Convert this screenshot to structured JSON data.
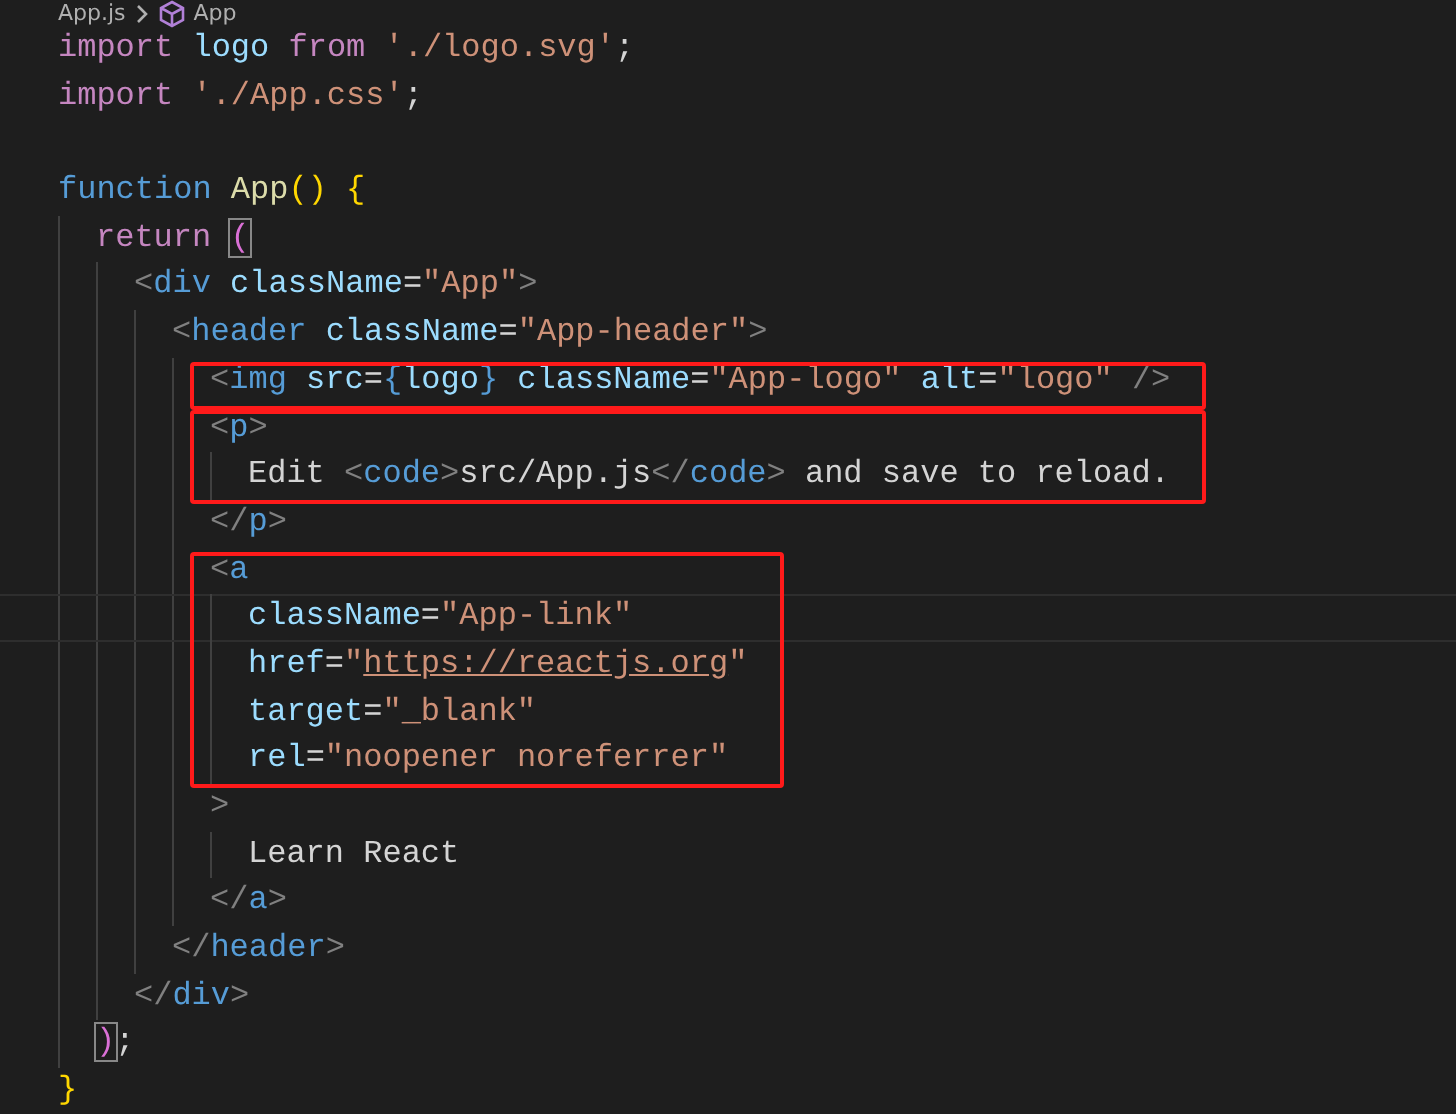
{
  "breadcrumb": {
    "file": "App.js",
    "symbol": "App"
  },
  "lines": [
    {
      "tokens": [
        {
          "kind": "keyword",
          "text": "import "
        },
        {
          "kind": "variable",
          "text": "logo "
        },
        {
          "kind": "keyword",
          "text": "from "
        },
        {
          "kind": "string",
          "text": "'./logo.svg'"
        },
        {
          "kind": "plain",
          "text": ";"
        }
      ],
      "highlighted": false,
      "current": false
    },
    {
      "tokens": [
        {
          "kind": "keyword",
          "text": "import "
        },
        {
          "kind": "string",
          "text": "'./App.css'"
        },
        {
          "kind": "plain",
          "text": ";"
        }
      ],
      "highlighted": false,
      "current": false
    },
    {
      "highlighted": false,
      "current": false
    },
    {
      "tokens": [
        {
          "kind": "storage",
          "text": "function "
        },
        {
          "kind": "function",
          "text": "App"
        },
        {
          "kind": "brace",
          "text": "() {"
        }
      ],
      "highlighted": false,
      "current": false,
      "children": [
        {
          "tokens": [
            {
              "kind": "keyword",
              "text": "return "
            },
            {
              "kind": "matched",
              "text": "("
            }
          ],
          "highlighted": false,
          "current": false,
          "children": [
            {
              "tokens": [
                {
                  "kind": "bracket",
                  "text": "<"
                },
                {
                  "kind": "storage",
                  "text": "div "
                },
                {
                  "kind": "variable",
                  "text": "className"
                },
                {
                  "kind": "plain",
                  "text": "="
                },
                {
                  "kind": "string",
                  "text": "\"App\""
                },
                {
                  "kind": "bracket",
                  "text": ">"
                }
              ],
              "highlighted": false,
              "current": false,
              "children": [
                {
                  "tokens": [
                    {
                      "kind": "bracket",
                      "text": "<"
                    },
                    {
                      "kind": "storage",
                      "text": "header "
                    },
                    {
                      "kind": "variable",
                      "text": "className"
                    },
                    {
                      "kind": "plain",
                      "text": "="
                    },
                    {
                      "kind": "string",
                      "text": "\"App-header\""
                    },
                    {
                      "kind": "bracket",
                      "text": ">"
                    }
                  ],
                  "highlighted": false,
                  "current": false,
                  "children": [
                    {
                      "tokens": [
                        {
                          "kind": "bracket",
                          "text": "<"
                        },
                        {
                          "kind": "storage",
                          "text": "img "
                        },
                        {
                          "kind": "variable",
                          "text": "src"
                        },
                        {
                          "kind": "plain",
                          "text": "="
                        },
                        {
                          "kind": "storage",
                          "text": "{"
                        },
                        {
                          "kind": "variable",
                          "text": "logo"
                        },
                        {
                          "kind": "storage",
                          "text": "} "
                        },
                        {
                          "kind": "variable",
                          "text": "className"
                        },
                        {
                          "kind": "plain",
                          "text": "="
                        },
                        {
                          "kind": "string",
                          "text": "\"App-logo\" "
                        },
                        {
                          "kind": "variable",
                          "text": "alt"
                        },
                        {
                          "kind": "plain",
                          "text": "="
                        },
                        {
                          "kind": "string",
                          "text": "\"logo\" "
                        },
                        {
                          "kind": "bracket",
                          "text": "/>"
                        }
                      ],
                      "highlighted": true,
                      "current": false
                    },
                    {
                      "tokens": [
                        {
                          "kind": "bracket",
                          "text": "<"
                        },
                        {
                          "kind": "storage",
                          "text": "p"
                        },
                        {
                          "kind": "bracket",
                          "text": ">"
                        }
                      ],
                      "highlighted": true,
                      "current": false,
                      "children": [
                        {
                          "tokens": [
                            {
                              "kind": "plain",
                              "text": "Edit "
                            },
                            {
                              "kind": "bracket",
                              "text": "<"
                            },
                            {
                              "kind": "storage",
                              "text": "code"
                            },
                            {
                              "kind": "bracket",
                              "text": ">"
                            },
                            {
                              "kind": "plain",
                              "text": "src/App.js"
                            },
                            {
                              "kind": "bracket",
                              "text": "</"
                            },
                            {
                              "kind": "storage",
                              "text": "code"
                            },
                            {
                              "kind": "bracket",
                              "text": ">"
                            },
                            {
                              "kind": "plain",
                              "text": " and save to reload."
                            }
                          ],
                          "highlighted": false,
                          "current": false
                        }
                      ]
                    },
                    {
                      "tokens": [
                        {
                          "kind": "bracket",
                          "text": "</"
                        },
                        {
                          "kind": "storage",
                          "text": "p"
                        },
                        {
                          "kind": "bracket",
                          "text": ">"
                        }
                      ],
                      "highlighted": false,
                      "current": false
                    },
                    {
                      "tokens": [
                        {
                          "kind": "bracket",
                          "text": "<"
                        },
                        {
                          "kind": "storage",
                          "text": "a"
                        }
                      ],
                      "highlighted": true,
                      "current": false,
                      "children": [
                        {
                          "tokens": [
                            {
                              "kind": "variable",
                              "text": "className"
                            },
                            {
                              "kind": "plain",
                              "text": "="
                            },
                            {
                              "kind": "string",
                              "text": "\"App-link\""
                            }
                          ],
                          "highlighted": false,
                          "current": true
                        },
                        {
                          "tokens": [
                            {
                              "kind": "variable",
                              "text": "href"
                            },
                            {
                              "kind": "plain",
                              "text": "="
                            },
                            {
                              "kind": "string",
                              "text": "\""
                            },
                            {
                              "kind": "link",
                              "text": "https://reactjs.org"
                            },
                            {
                              "kind": "string",
                              "text": "\""
                            }
                          ],
                          "highlighted": false,
                          "current": false
                        },
                        {
                          "tokens": [
                            {
                              "kind": "variable",
                              "text": "target"
                            },
                            {
                              "kind": "plain",
                              "text": "="
                            },
                            {
                              "kind": "string",
                              "text": "\"_blank\""
                            }
                          ],
                          "highlighted": false,
                          "current": false
                        },
                        {
                          "tokens": [
                            {
                              "kind": "variable",
                              "text": "rel"
                            },
                            {
                              "kind": "plain",
                              "text": "="
                            },
                            {
                              "kind": "string",
                              "text": "\"noopener noreferrer\""
                            }
                          ],
                          "highlighted": false,
                          "current": false
                        }
                      ]
                    },
                    {
                      "tokens": [
                        {
                          "kind": "bracket",
                          "text": ">"
                        }
                      ],
                      "highlighted": false,
                      "current": false,
                      "children": [
                        {
                          "tokens": [
                            {
                              "kind": "plain",
                              "text": "Learn React"
                            }
                          ],
                          "highlighted": false,
                          "current": false
                        }
                      ]
                    },
                    {
                      "tokens": [
                        {
                          "kind": "bracket",
                          "text": "</"
                        },
                        {
                          "kind": "storage",
                          "text": "a"
                        },
                        {
                          "kind": "bracket",
                          "text": ">"
                        }
                      ],
                      "highlighted": false,
                      "current": false
                    }
                  ]
                },
                {
                  "tokens": [
                    {
                      "kind": "bracket",
                      "text": "</"
                    },
                    {
                      "kind": "storage",
                      "text": "header"
                    },
                    {
                      "kind": "bracket",
                      "text": ">"
                    }
                  ],
                  "highlighted": false,
                  "current": false
                }
              ]
            },
            {
              "tokens": [
                {
                  "kind": "bracket",
                  "text": "</"
                },
                {
                  "kind": "storage",
                  "text": "div"
                },
                {
                  "kind": "bracket",
                  "text": ">"
                }
              ],
              "highlighted": false,
              "current": false
            }
          ]
        },
        {
          "tokens": [
            {
              "kind": "matched",
              "text": ")"
            },
            {
              "kind": "plain",
              "text": ";"
            }
          ],
          "highlighted": false,
          "current": false
        }
      ]
    },
    {
      "tokens": [
        {
          "kind": "brace",
          "text": "}"
        }
      ],
      "highlighted": false,
      "current": false
    }
  ]
}
